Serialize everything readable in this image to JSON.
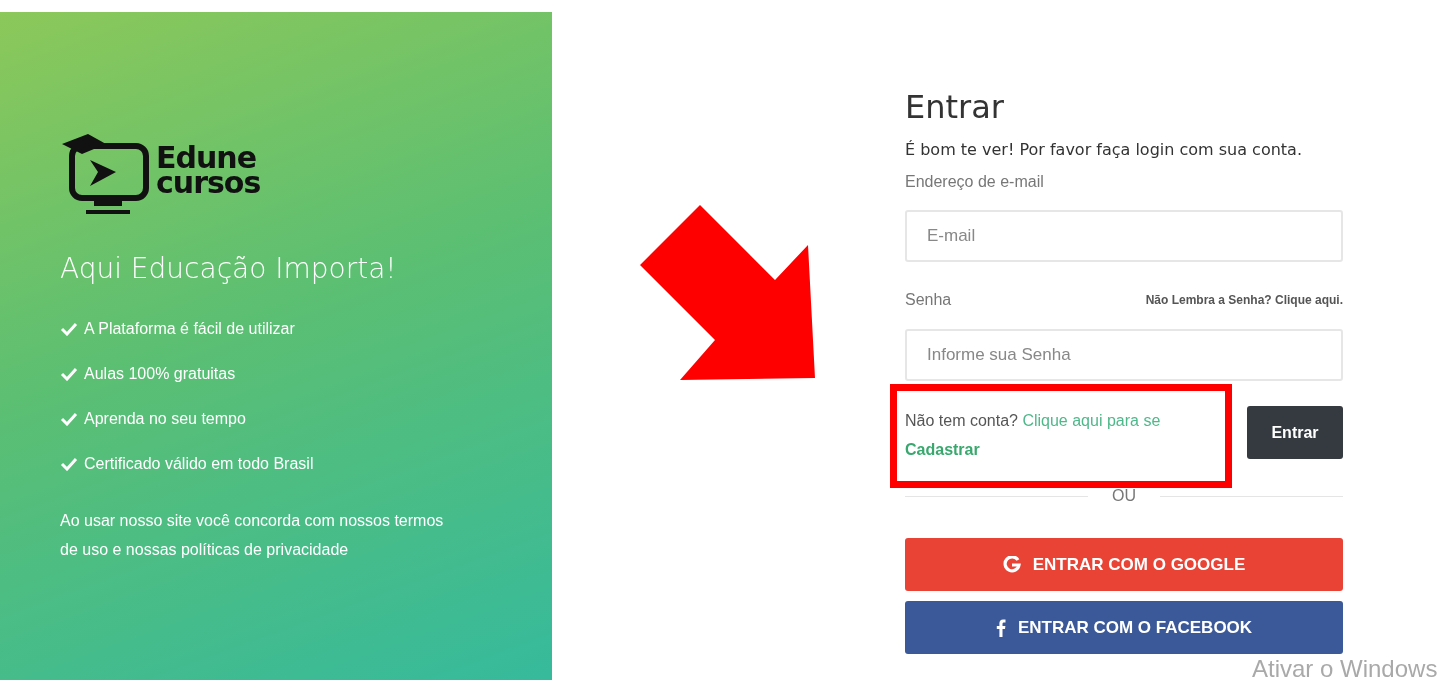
{
  "brand_panel": {
    "logo": {
      "line_1": "Edune",
      "line_2": "cursos"
    },
    "tagline": "Aqui Educação Importa!",
    "features": [
      "A Plataforma é fácil de utilizar",
      "Aulas 100% gratuitas",
      "Aprenda no seu tempo",
      "Certificado válido em todo Brasil"
    ],
    "terms": "Ao usar nosso site você concorda com nossos termos de uso e nossas políticas de privacidade"
  },
  "login_form": {
    "title": "Entrar",
    "subtitle": "É bom te ver! Por favor faça login com sua conta.",
    "email": {
      "label": "Endereço de e-mail",
      "placeholder": "E-mail"
    },
    "password": {
      "label": "Senha",
      "forgot_link": "Não Lembra a Senha? Clique aqui.",
      "placeholder": "Informe sua Senha"
    },
    "signup": {
      "prompt": "Não tem conta?",
      "link": "Clique aqui para se",
      "link_bold": "Cadastrar"
    },
    "submit_button": "Entrar",
    "divider": "OU",
    "social_buttons": [
      {
        "kind": "google",
        "label": "ENTRAR COM O GOOGLE",
        "color": "#e94335"
      },
      {
        "kind": "facebook",
        "label": "ENTRAR COM O FACEBOOK",
        "color": "#3b5998"
      }
    ]
  },
  "annotations": {
    "arrow": true,
    "highlight_box": true
  },
  "windows_watermark": "Ativar o Windows"
}
